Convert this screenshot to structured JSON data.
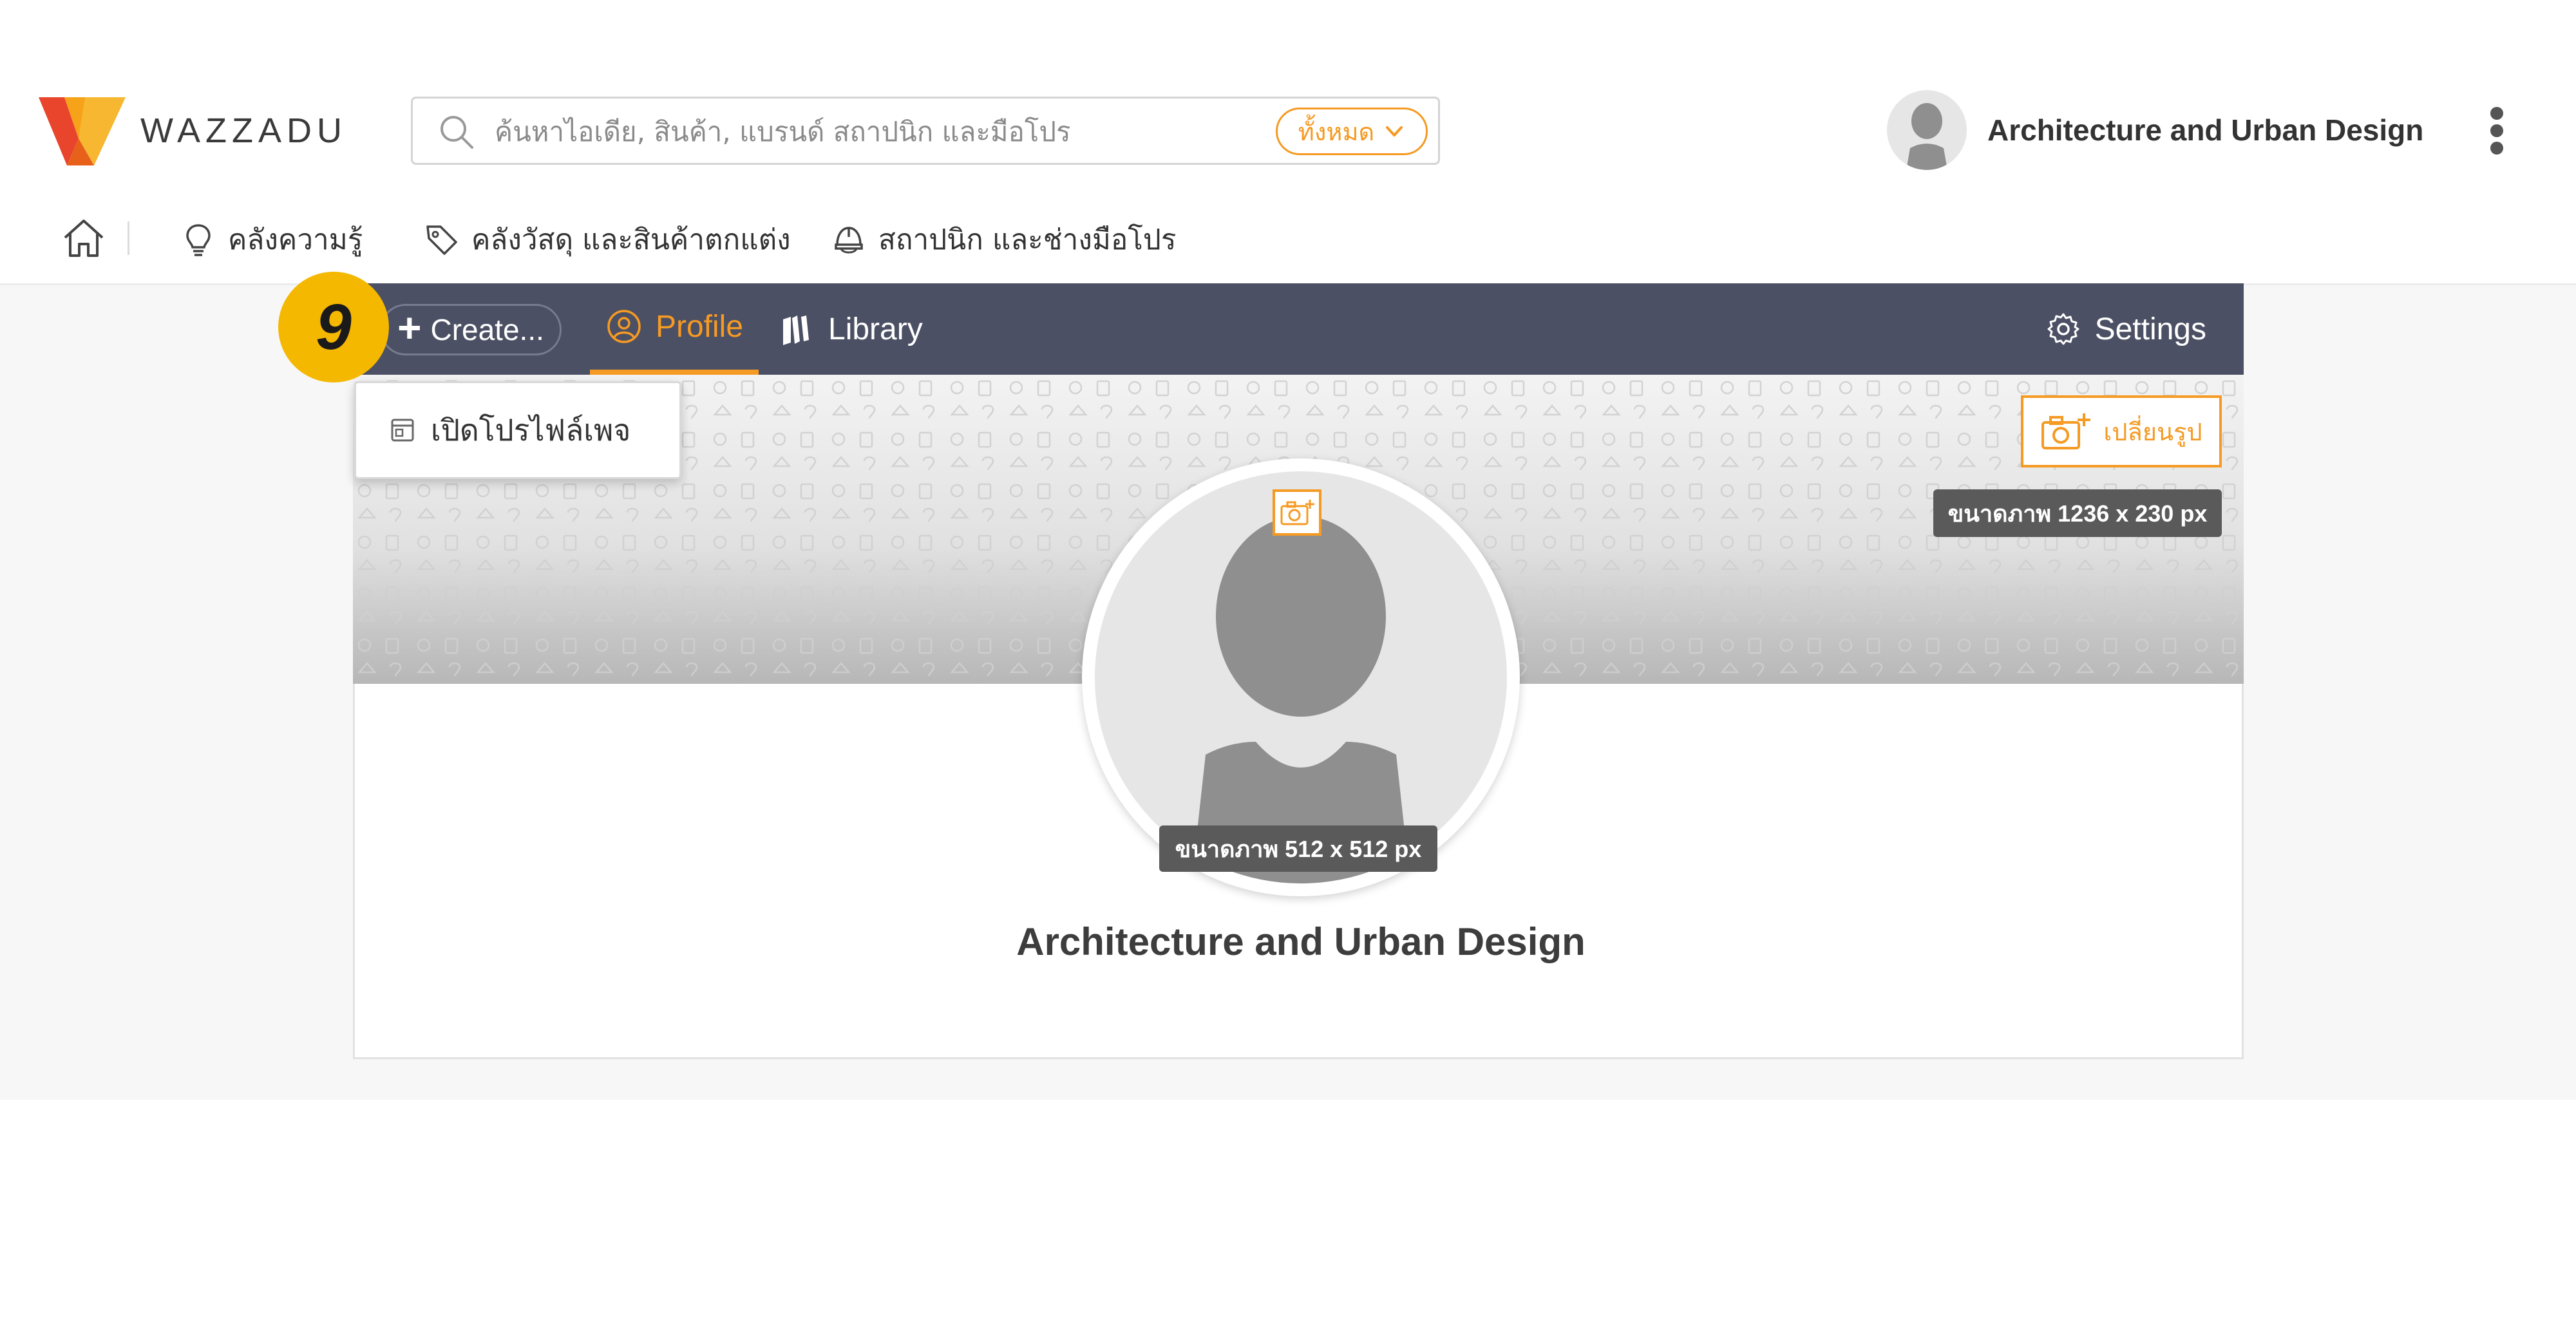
{
  "brand": {
    "name": "WAZZADU"
  },
  "search": {
    "placeholder": "ค้นหาไอเดีย, สินค้า, แบรนด์ สถาปนิก และมือโปร",
    "filter_label": "ทั้งหมด"
  },
  "user": {
    "name": "Architecture and Urban Design"
  },
  "nav": {
    "items": [
      {
        "label": "คลังความรู้",
        "icon": "lightbulb-icon"
      },
      {
        "label": "คลังวัสดุ และสินค้าตกแต่ง",
        "icon": "tag-icon"
      },
      {
        "label": "สถาปนิก และช่างมือโปร",
        "icon": "helmet-icon"
      }
    ]
  },
  "toolbar": {
    "create_label": "Create...",
    "tabs": [
      {
        "label": "Profile",
        "active": true,
        "icon": "user-circle-icon"
      },
      {
        "label": "Library",
        "active": false,
        "icon": "books-icon"
      }
    ],
    "settings_label": "Settings"
  },
  "step_badge": "9",
  "dropdown": {
    "items": [
      {
        "label": "เปิดโปรไฟล์เพจ",
        "icon": "page-icon"
      }
    ]
  },
  "cover": {
    "change_label": "เปลี่ยนรูป",
    "size_label": "ขนาดภาพ 1236 x 230 px"
  },
  "avatar": {
    "size_label": "ขนาดภาพ 512 x 512 px"
  },
  "profile": {
    "name": "Architecture and Urban Design"
  },
  "colors": {
    "accent": "#f59a23",
    "toolbar": "#4c5064",
    "badge": "#f5b800"
  }
}
